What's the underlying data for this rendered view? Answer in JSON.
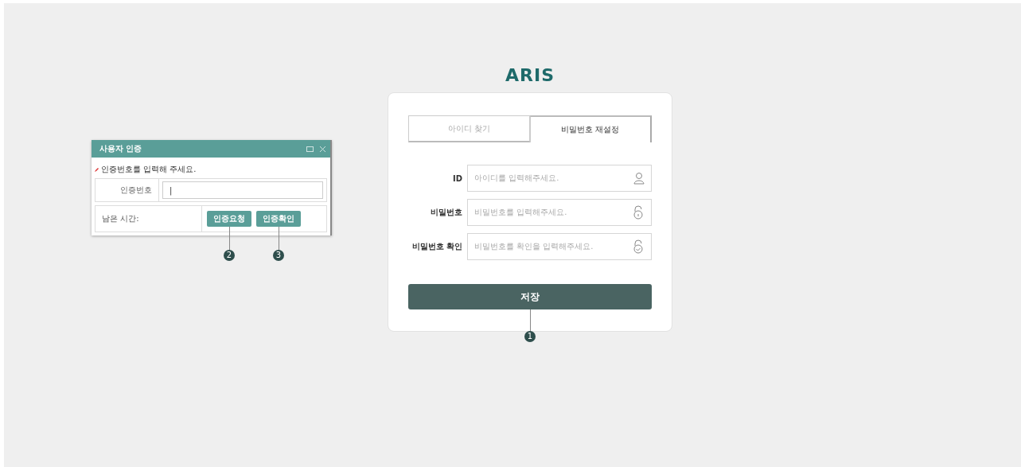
{
  "logo": {
    "text": "ARIS"
  },
  "dialog": {
    "title": "사용자 인증",
    "message": "인증번호를 입력해 주세요.",
    "code_label": "인증번호",
    "code_value": "|",
    "timer_label": "남은 시간:",
    "buttons": [
      {
        "label": "인증요청",
        "callout": "2"
      },
      {
        "label": "인증확인",
        "callout": "3"
      }
    ]
  },
  "tabs": [
    {
      "label": "아이디 찾기",
      "selected": false
    },
    {
      "label": "비밀번호 재설정",
      "selected": true
    }
  ],
  "fields": [
    {
      "label": "ID",
      "placeholder": "아이디를 입력해주세요.",
      "kind": "user"
    },
    {
      "label": "비밀번호",
      "placeholder": "비밀번호를 입력해주세요.",
      "kind": "lock"
    },
    {
      "label": "비밀번호 확인",
      "placeholder": "비밀번호를 확인을 입력해주세요.",
      "kind": "lock-check"
    }
  ],
  "save_button": {
    "label": "저장",
    "callout": "1"
  }
}
